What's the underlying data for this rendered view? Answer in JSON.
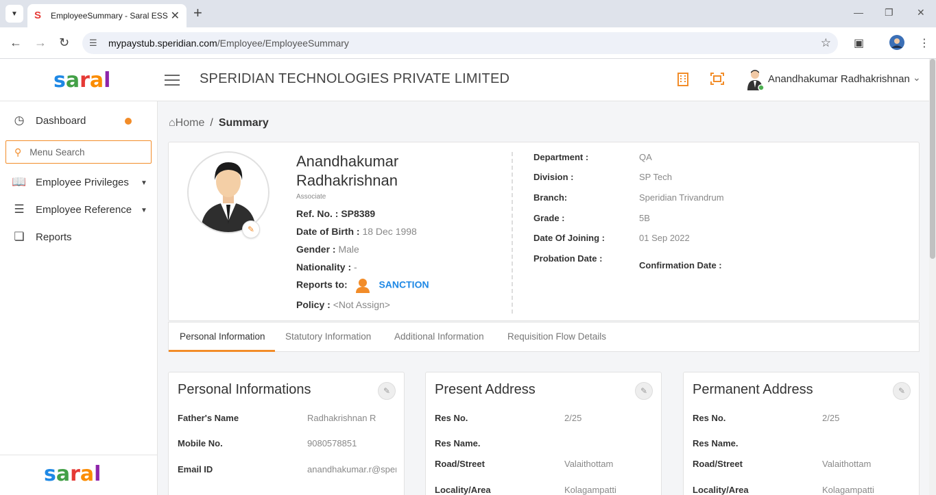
{
  "browser": {
    "tab_title": "EmployeeSummary - Saral ESS",
    "tab_favicon": "S",
    "url_host": "mypaystub.speridian.com",
    "url_path": "/Employee/EmployeeSummary"
  },
  "header": {
    "logo_text": [
      "s",
      "a",
      "r",
      "a",
      "l"
    ],
    "company": "SPERIDIAN TECHNOLOGIES PRIVATE LIMITED",
    "user_name": "Anandhakumar Radhakrishnan",
    "accent_color": "#f28c28"
  },
  "sidebar": {
    "dashboard": "Dashboard",
    "search_placeholder": "Menu Search",
    "items": [
      {
        "label": "Employee Privileges"
      },
      {
        "label": "Employee Reference"
      },
      {
        "label": "Reports"
      }
    ]
  },
  "breadcrumb": {
    "home": "Home",
    "sep": "/",
    "current": "Summary"
  },
  "profile": {
    "name_line1": "Anandhakumar",
    "name_line2": "Radhakrishnan",
    "designation": "Associate",
    "ref_label": "Ref. No. :",
    "ref_value": "SP8389",
    "dob_label": "Date of Birth :",
    "dob_value": "18 Dec 1998",
    "gender_label": "Gender :",
    "gender_value": "Male",
    "nationality_label": "Nationality :",
    "nationality_value": "-",
    "reports_label": "Reports to:",
    "reports_value": "SANCTION",
    "policy_label": "Policy :",
    "policy_value": "<Not Assign>",
    "right": [
      {
        "label": "Department :",
        "value": "QA"
      },
      {
        "label": "Division :",
        "value": "SP Tech"
      },
      {
        "label": "Branch:",
        "value": "Speridian Trivandrum"
      },
      {
        "label": "Grade :",
        "value": "5B"
      },
      {
        "label": "Date Of Joining :",
        "value": "01 Sep 2022"
      },
      {
        "label": "Probation Date :",
        "value": ""
      }
    ],
    "confirmation_label": "Confirmation Date :"
  },
  "tabs": [
    "Personal Information",
    "Statutory Information",
    "Additional Information",
    "Requisition Flow Details"
  ],
  "cards": {
    "personal": {
      "title": "Personal Informations",
      "rows": [
        {
          "label": "Father's Name",
          "value": "Radhakrishnan R"
        },
        {
          "label": "Mobile No.",
          "value": "9080578851"
        },
        {
          "label": "Email ID",
          "value": "anandhakumar.r@speridian.com"
        }
      ]
    },
    "present": {
      "title": "Present Address",
      "rows": [
        {
          "label": "Res No.",
          "value": "2/25"
        },
        {
          "label": "Res Name.",
          "value": ""
        },
        {
          "label": "Road/Street",
          "value": "Valaithottam"
        },
        {
          "label": "Locality/Area",
          "value": "Kolagampatti"
        }
      ]
    },
    "permanent": {
      "title": "Permanent Address",
      "rows": [
        {
          "label": "Res No.",
          "value": "2/25"
        },
        {
          "label": "Res Name.",
          "value": ""
        },
        {
          "label": "Road/Street",
          "value": "Valaithottam"
        },
        {
          "label": "Locality/Area",
          "value": "Kolagampatti"
        }
      ]
    }
  }
}
